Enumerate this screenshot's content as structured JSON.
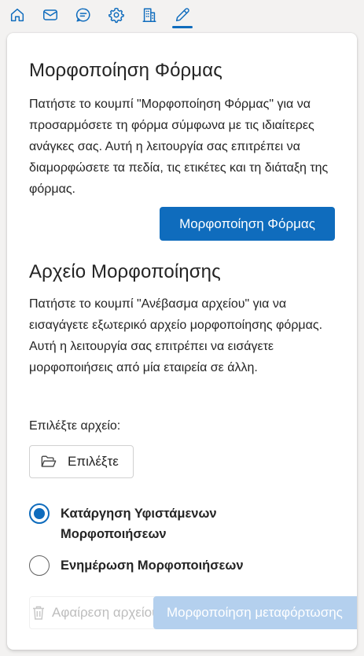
{
  "nav": {
    "active_tab": "edit",
    "accent_color": "#0f6cbd",
    "tabs": [
      {
        "icon": "home-icon"
      },
      {
        "icon": "mail-icon"
      },
      {
        "icon": "chat-icon"
      },
      {
        "icon": "gear-icon"
      },
      {
        "icon": "building-icon"
      },
      {
        "icon": "pencil-icon"
      }
    ]
  },
  "form_formatting": {
    "title": "Μορφοποίηση Φόρμας",
    "description": "Πατήστε το κουμπί \"Μορφοποίηση Φόρμας\" για να προσαρμόσετε τη φόρμα σύμφωνα με τις ιδιαίτερες ανάγκες σας. Αυτή η λειτουργία σας επιτρέπει να διαμορφώσετε τα πεδία, τις ετικέτες και τη διάταξη της φόρμας.",
    "button_label": "Μορφοποίηση Φόρμας"
  },
  "formatting_file": {
    "title": "Αρχείο Μορφοποίησης",
    "description": "Πατήστε το κουμπί \"Ανέβασμα αρχείου\" για να εισαγάγετε εξωτερικό αρχείο μορφοποίησης φόρμας. Αυτή η λειτουργία σας επιτρέπει να εισάγετε μορφοποιήσεις από μία εταιρεία σε άλλη.",
    "select_label": "Επιλέξτε αρχείο:",
    "choose_button_label": "Επιλέξτε",
    "options": [
      {
        "label": "Κατάργηση Υφιστάμενων Μορφοποιήσεων",
        "checked": true
      },
      {
        "label": "Ενημέρωση Μορφοποιήσεων",
        "checked": false
      }
    ],
    "remove_file_label": "Αφαίρεση αρχείου",
    "upload_format_label": "Μορφοποίηση μεταφόρτωσης"
  }
}
